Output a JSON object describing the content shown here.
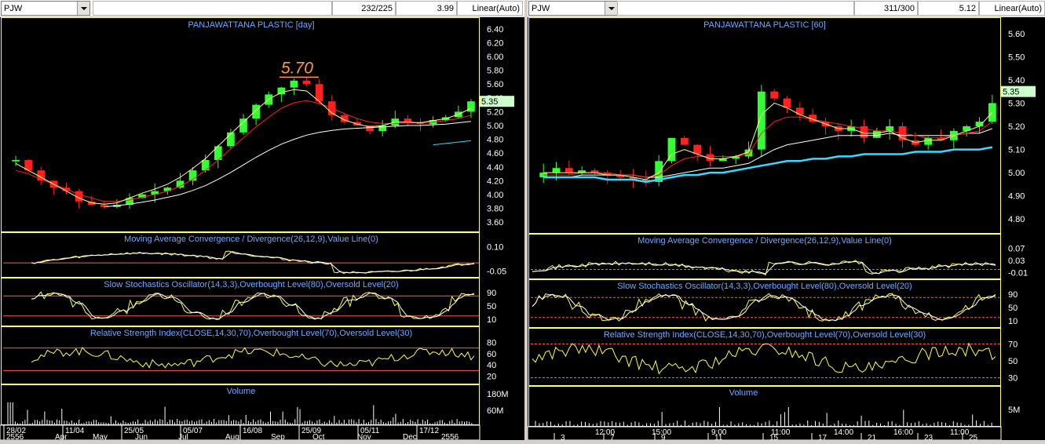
{
  "left": {
    "symbol": "PJW",
    "counter": "232/225",
    "value": "3.99",
    "scale_mode": "Linear(Auto)",
    "price_title": "PANJAWATTANA PLASTIC [day]",
    "peak_annotation": "5.70",
    "last_price": "5.35",
    "macd_title": "Moving Average Convergence / Divergence(26,12,9),Value Line(0)",
    "stoch_title": "Slow Stochastics Oscillator(14,3,3),Overbought Level(80),Oversold Level(20)",
    "rsi_title": "Relative Strength Index(CLOSE,14,30,70),Overbought Level(70),Oversold Level(30)",
    "volume_title": "Volume",
    "price_ticks": [
      "6.40",
      "6.20",
      "6.00",
      "5.80",
      "5.60",
      "5.40",
      "5.20",
      "5.00",
      "4.80",
      "4.60",
      "4.40",
      "4.20",
      "4.00",
      "3.80",
      "3.60"
    ],
    "macd_ticks": [
      "0.10",
      "-0.05"
    ],
    "stoch_ticks": [
      "90",
      "50",
      "10"
    ],
    "rsi_ticks": [
      "80",
      "60",
      "40",
      "20"
    ],
    "volume_ticks": [
      "180M",
      "60M"
    ],
    "date_row1": [
      "28/02",
      "11/04",
      "25/05",
      "05/07",
      "16/08",
      "25/09",
      "05/11",
      "17/12"
    ],
    "date_row2": [
      "2556",
      "Apr",
      "May",
      "Jun",
      "Jul",
      "Aug",
      "Sep",
      "Oct",
      "Nov",
      "Dec",
      "2556"
    ]
  },
  "right": {
    "symbol": "PJW",
    "counter": "311/300",
    "value": "5.12",
    "scale_mode": "Linear(Auto)",
    "price_title": "PANJAWATTANA PLASTIC [60]",
    "last_price": "5.35",
    "macd_title": "Moving Average Convergence / Divergence(26,12,9),Value Line(0)",
    "stoch_title": "Slow Stochastics Oscillator(14,3,3),Overbought Level(80),Oversold Level(20)",
    "rsi_title": "Relative Strength Index(CLOSE,14,30,70),Overbought Level(70),Oversold Level(30)",
    "volume_title": "Volume",
    "price_ticks": [
      "5.60",
      "5.50",
      "5.40",
      "5.30",
      "5.20",
      "5.10",
      "5.00",
      "4.90",
      "4.80"
    ],
    "macd_ticks": [
      "0.07",
      "0.03",
      "-0.01"
    ],
    "stoch_ticks": [
      "90",
      "50",
      "10"
    ],
    "rsi_ticks": [
      "70",
      "50",
      "30"
    ],
    "volume_ticks": [
      "5M"
    ],
    "time_row1": [
      "12:00",
      "15:00",
      "9:00",
      "11:00",
      "14:00",
      "16:00",
      "11:00"
    ],
    "time_row2": [
      "3",
      "7",
      "9",
      "11",
      "15",
      "17",
      "21",
      "23",
      "25"
    ]
  },
  "colors": {
    "background": "#000000",
    "panel_border": "#ffff66",
    "title_blue": "#6fa8ff",
    "level_red": "#ff5a5a",
    "green": "#33ff33",
    "red": "#ff2020",
    "white": "#ffffff",
    "cyan": "#33ddff",
    "price_label_bg": "#ccffcc",
    "annotation": "#ff9933"
  },
  "chart_data": [
    {
      "type": "candlestick",
      "title": "PANJAWATTANA PLASTIC [day]",
      "ylim": [
        3.5,
        6.5
      ],
      "x_categories": [
        "Apr",
        "May",
        "Jun",
        "Jul",
        "Aug",
        "Sep",
        "Oct",
        "Nov",
        "Dec"
      ],
      "close": [
        4.5,
        4.35,
        4.2,
        4.1,
        4.05,
        3.9,
        3.85,
        3.82,
        3.85,
        3.95,
        4.0,
        4.05,
        4.1,
        4.2,
        4.35,
        4.5,
        4.7,
        4.9,
        5.1,
        5.3,
        5.45,
        5.55,
        5.65,
        5.6,
        5.35,
        5.15,
        5.05,
        5.0,
        4.92,
        5.0,
        5.1,
        5.05,
        5.02,
        5.08,
        5.12,
        5.2,
        5.35
      ],
      "ma_fast": [
        4.45,
        4.35,
        4.25,
        4.15,
        4.05,
        3.95,
        3.88,
        3.86,
        3.88,
        3.95,
        4.02,
        4.08,
        4.15,
        4.25,
        4.38,
        4.52,
        4.7,
        4.88,
        5.05,
        5.22,
        5.38,
        5.48,
        5.52,
        5.5,
        5.35,
        5.18,
        5.08,
        5.02,
        4.98,
        5.0,
        5.05,
        5.05,
        5.04,
        5.07,
        5.1,
        5.16,
        5.25
      ],
      "ma_slow": [
        4.35,
        4.3,
        4.22,
        4.15,
        4.08,
        4.0,
        3.95,
        3.9,
        3.9,
        3.92,
        3.96,
        4.0,
        4.05,
        4.12,
        4.22,
        4.35,
        4.5,
        4.66,
        4.82,
        4.98,
        5.12,
        5.25,
        5.33,
        5.36,
        5.32,
        5.25,
        5.17,
        5.1,
        5.05,
        5.03,
        5.03,
        5.04,
        5.04,
        5.05,
        5.07,
        5.1,
        5.15
      ],
      "ma_long": [
        null,
        null,
        null,
        null,
        null,
        null,
        null,
        3.82,
        3.84,
        3.86,
        3.89,
        3.92,
        3.96,
        4.0,
        4.06,
        4.13,
        4.22,
        4.32,
        4.43,
        4.54,
        4.64,
        4.73,
        4.8,
        4.86,
        4.9,
        4.93,
        4.95,
        4.96,
        4.97,
        4.98,
        4.99,
        5.0,
        5.0,
        5.01,
        5.02,
        5.04,
        5.06
      ],
      "ma_cyan": [
        4.72,
        4.74,
        4.76,
        4.78
      ],
      "peak": 5.7,
      "last": 5.35
    },
    {
      "type": "candlestick",
      "title": "PANJAWATTANA PLASTIC [60]",
      "ylim": [
        4.75,
        5.65
      ],
      "x_categories": [
        "3",
        "7",
        "9",
        "11",
        "15",
        "17",
        "21",
        "23",
        "25"
      ],
      "close": [
        5.0,
        5.02,
        5.0,
        5.01,
        5.0,
        4.99,
        4.98,
        4.97,
        4.96,
        5.05,
        5.15,
        5.12,
        5.08,
        5.05,
        5.06,
        5.07,
        5.1,
        5.35,
        5.32,
        5.28,
        5.25,
        5.22,
        5.2,
        5.18,
        5.2,
        5.15,
        5.18,
        5.2,
        5.14,
        5.12,
        5.15,
        5.14,
        5.18,
        5.2,
        5.22,
        5.3
      ],
      "ma_fast": [
        5.0,
        5.0,
        5.0,
        5.0,
        5.0,
        4.99,
        4.99,
        4.98,
        4.97,
        5.0,
        5.08,
        5.1,
        5.08,
        5.06,
        5.06,
        5.07,
        5.09,
        5.25,
        5.3,
        5.28,
        5.25,
        5.23,
        5.21,
        5.19,
        5.19,
        5.17,
        5.17,
        5.18,
        5.15,
        5.13,
        5.14,
        5.14,
        5.16,
        5.18,
        5.2,
        5.26
      ],
      "ma_slow": [
        4.99,
        4.99,
        4.99,
        5.0,
        5.0,
        5.0,
        4.99,
        4.99,
        4.98,
        4.99,
        5.03,
        5.06,
        5.07,
        5.07,
        5.07,
        5.07,
        5.08,
        5.17,
        5.22,
        5.24,
        5.24,
        5.23,
        5.22,
        5.21,
        5.2,
        5.19,
        5.18,
        5.18,
        5.17,
        5.16,
        5.15,
        5.15,
        5.16,
        5.17,
        5.18,
        5.22
      ],
      "ma_long": [
        4.98,
        4.98,
        4.98,
        4.99,
        4.99,
        4.99,
        4.99,
        4.99,
        4.98,
        4.98,
        4.99,
        5.0,
        5.01,
        5.02,
        5.02,
        5.03,
        5.04,
        5.07,
        5.1,
        5.12,
        5.13,
        5.14,
        5.15,
        5.16,
        5.16,
        5.16,
        5.16,
        5.17,
        5.16,
        5.16,
        5.16,
        5.16,
        5.16,
        5.17,
        5.17,
        5.19
      ],
      "ma_cyan": [
        4.98,
        4.98,
        4.98,
        4.98,
        4.98,
        4.97,
        4.97,
        4.97,
        4.96,
        4.97,
        4.98,
        4.99,
        4.99,
        5.0,
        5.0,
        5.01,
        5.02,
        5.03,
        5.04,
        5.05,
        5.05,
        5.06,
        5.06,
        5.07,
        5.07,
        5.08,
        5.08,
        5.08,
        5.08,
        5.09,
        5.09,
        5.09,
        5.1,
        5.1,
        5.1,
        5.11
      ],
      "last": 5.35
    }
  ]
}
